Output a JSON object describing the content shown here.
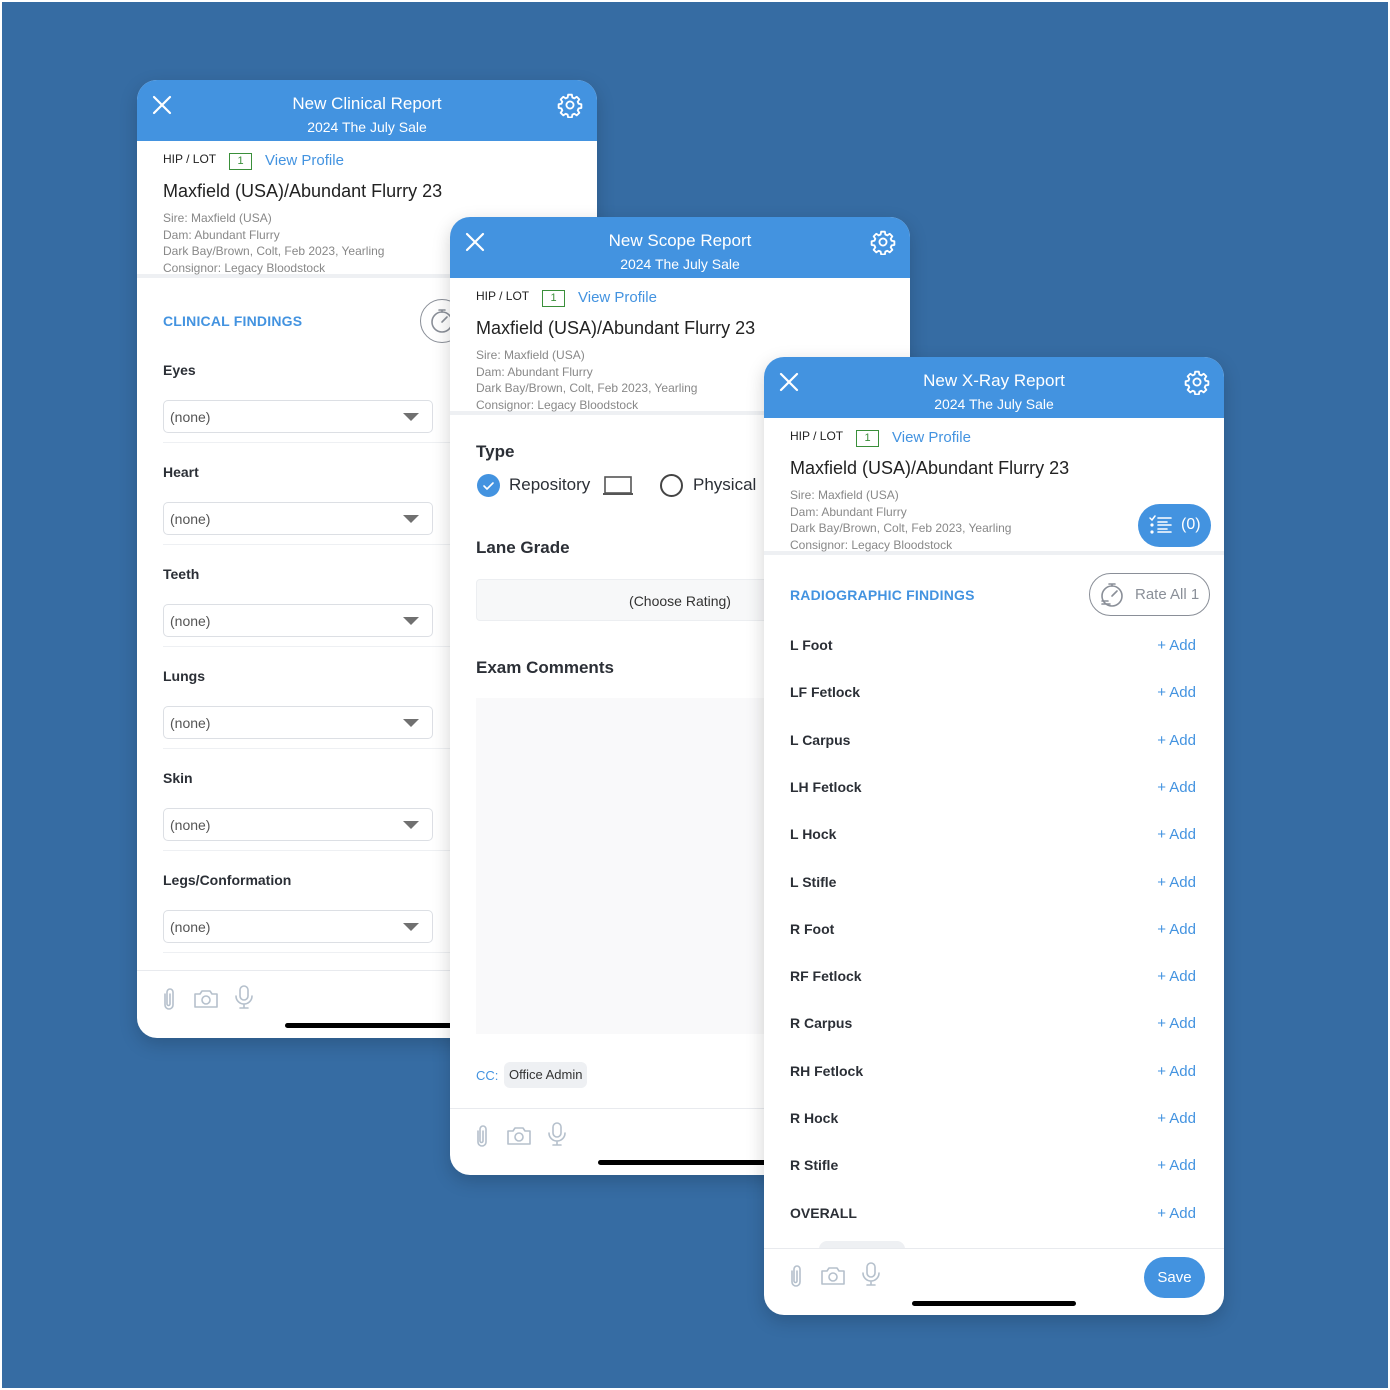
{
  "colors": {
    "background": "#366ca3",
    "accent": "#4393e0",
    "hip_box": "#3a8f3a",
    "text_dark": "#2b2f36",
    "text_muted": "#888888"
  },
  "horse": {
    "hip_label": "HIP / LOT",
    "hip_number": "1",
    "view_profile": "View Profile",
    "name": "Maxfield (USA)/Abundant Flurry 23",
    "sire": "Sire: Maxfield (USA)",
    "dam": "Dam: Abundant Flurry",
    "description": "Dark Bay/Brown, Colt, Feb 2023, Yearling",
    "consignor": "Consignor: Legacy Bloodstock"
  },
  "clinical": {
    "title": "New Clinical Report",
    "subtitle": "2024 The July Sale",
    "section_title": "CLINICAL FINDINGS",
    "fields": [
      {
        "label": "Eyes",
        "value": "(none)"
      },
      {
        "label": "Heart",
        "value": "(none)"
      },
      {
        "label": "Teeth",
        "value": "(none)"
      },
      {
        "label": "Lungs",
        "value": "(none)"
      },
      {
        "label": "Skin",
        "value": "(none)"
      },
      {
        "label": "Legs/Conformation",
        "value": "(none)"
      }
    ]
  },
  "scope": {
    "title": "New Scope Report",
    "subtitle": "2024 The July Sale",
    "type_label": "Type",
    "type_options": [
      {
        "label": "Repository",
        "selected": true
      },
      {
        "label": "Physical",
        "selected": false
      }
    ],
    "lane_grade_label": "Lane Grade",
    "lane_grade_value": "(Choose Rating)",
    "comments_label": "Exam Comments",
    "comments_value": "",
    "cc_label": "CC:",
    "cc_recipient": "Office Admin"
  },
  "xray": {
    "title": "New X-Ray Report",
    "subtitle": "2024 The July Sale",
    "summary_count": "(0)",
    "section_title": "RADIOGRAPHIC FINDINGS",
    "rate_all_label": "Rate All 1",
    "add_label": "+ Add",
    "findings": [
      "L Foot",
      "LF Fetlock",
      "L Carpus",
      "LH Fetlock",
      "L Hock",
      "L Stifle",
      "R Foot",
      "RF Fetlock",
      "R Carpus",
      "RH Fetlock",
      "R Hock",
      "R Stifle",
      "OVERALL"
    ],
    "save_label": "Save"
  },
  "footer_icons": [
    "paperclip-icon",
    "camera-icon",
    "microphone-icon"
  ]
}
